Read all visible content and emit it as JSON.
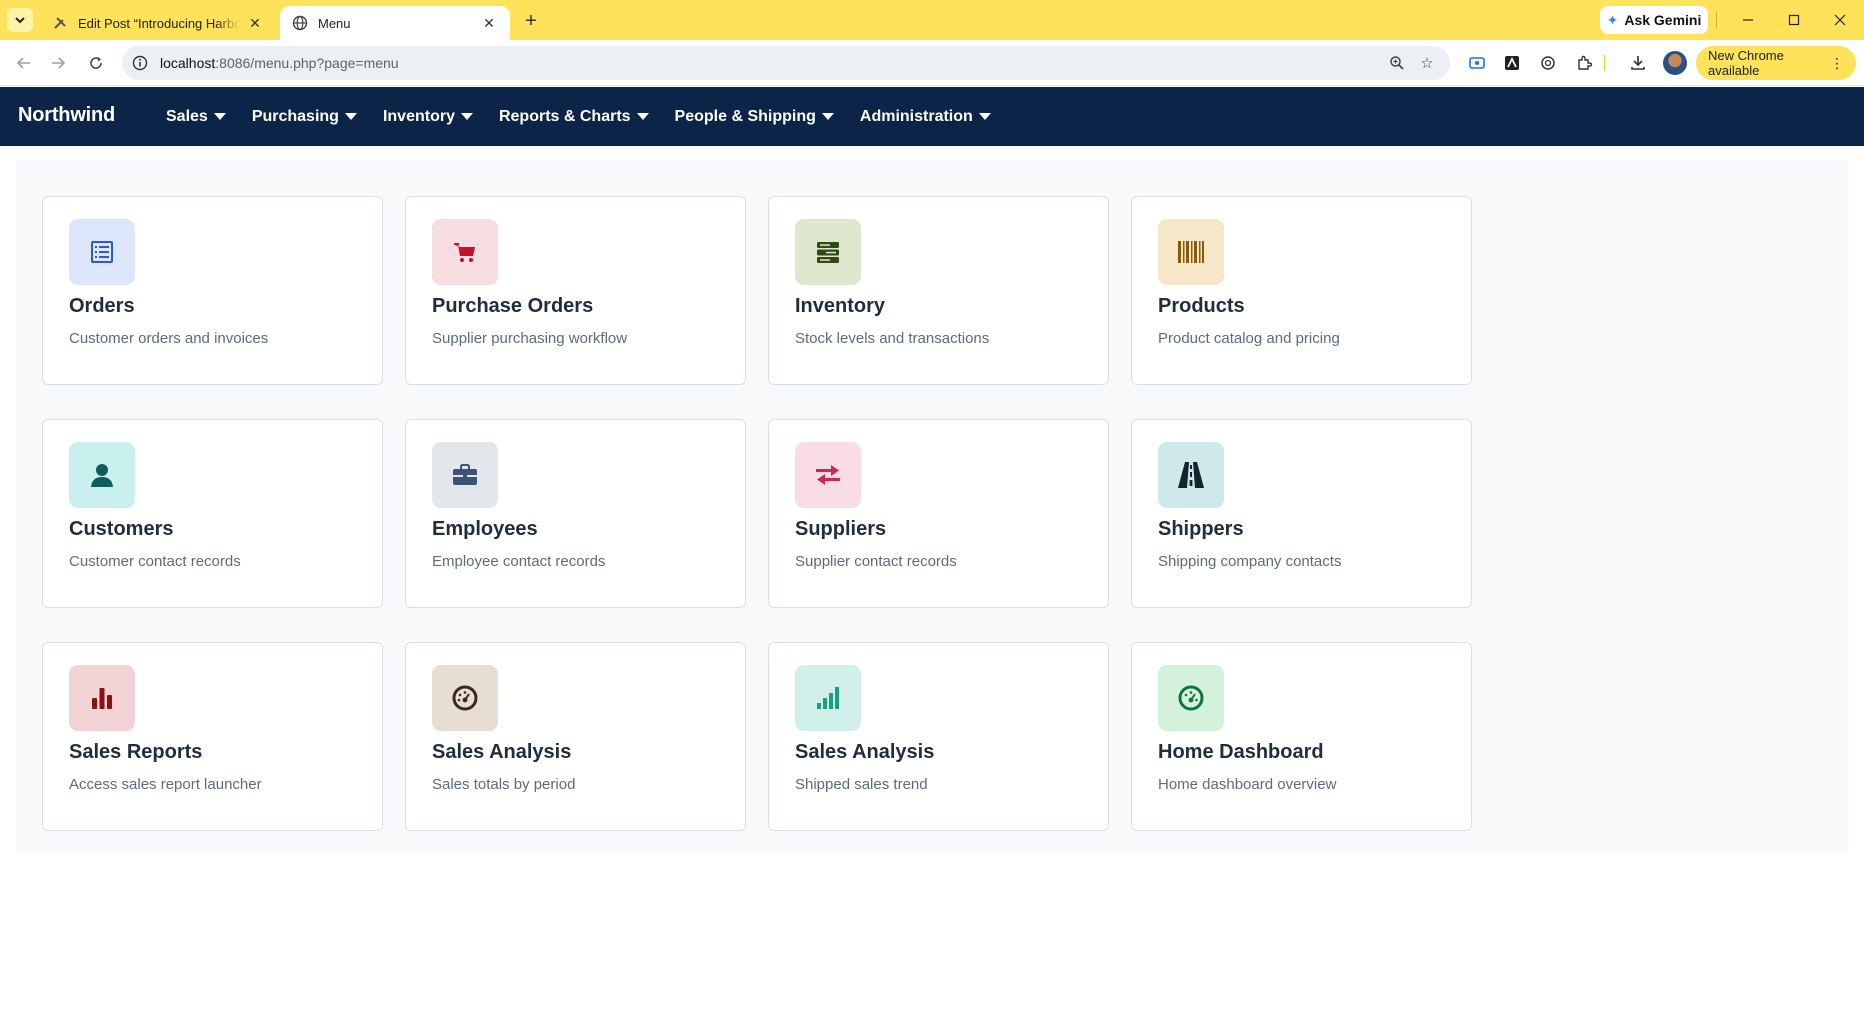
{
  "browser": {
    "tabs": [
      {
        "title": "Edit Post “Introducing Harbor: A",
        "active": false
      },
      {
        "title": "Menu",
        "active": true
      }
    ],
    "gemini_label": "Ask Gemini",
    "url_host": "localhost",
    "url_path": ":8086/menu.php?page=menu",
    "update_label": "New Chrome available"
  },
  "appnav": {
    "brand": "Northwind",
    "menus": [
      {
        "label": "Sales"
      },
      {
        "label": "Purchasing"
      },
      {
        "label": "Inventory"
      },
      {
        "label": "Reports & Charts"
      },
      {
        "label": "People & Shipping"
      },
      {
        "label": "Administration"
      }
    ]
  },
  "cards": [
    {
      "title": "Orders",
      "desc": "Customer orders and invoices",
      "icon": "list-icon",
      "tile": "#dce7fb",
      "fg": "#2a5bd7"
    },
    {
      "title": "Purchase Orders",
      "desc": "Supplier purchasing workflow",
      "icon": "cart-icon",
      "tile": "#f6dde0",
      "fg": "#c8102e"
    },
    {
      "title": "Inventory",
      "desc": "Stock levels and transactions",
      "icon": "server-icon",
      "tile": "#dfe8cf",
      "fg": "#2f4a14"
    },
    {
      "title": "Products",
      "desc": "Product catalog and pricing",
      "icon": "barcode-icon",
      "tile": "#f7e7c9",
      "fg": "#8a5a05"
    },
    {
      "title": "Customers",
      "desc": "Customer contact records",
      "icon": "user-icon",
      "tile": "#c9f0ee",
      "fg": "#0f5d5d"
    },
    {
      "title": "Employees",
      "desc": "Employee contact records",
      "icon": "briefcase-icon",
      "tile": "#e3e6eb",
      "fg": "#3b5375"
    },
    {
      "title": "Suppliers",
      "desc": "Supplier contact records",
      "icon": "exchange-icon",
      "tile": "#f8dde6",
      "fg": "#d0245a"
    },
    {
      "title": "Shippers",
      "desc": "Shipping company contacts",
      "icon": "road-icon",
      "tile": "#cfe9ea",
      "fg": "#12242e"
    },
    {
      "title": "Sales Reports",
      "desc": "Access sales report launcher",
      "icon": "bar-chart-icon",
      "tile": "#f2d3d5",
      "fg": "#8b0f14"
    },
    {
      "title": "Sales Analysis",
      "desc": "Sales totals by period",
      "icon": "gauge-icon",
      "tile": "#e8ddd2",
      "fg": "#3b2a17"
    },
    {
      "title": "Sales Analysis",
      "desc": "Shipped sales trend",
      "icon": "signal-icon",
      "tile": "#d2f0ea",
      "fg": "#1b9e86"
    },
    {
      "title": "Home Dashboard",
      "desc": "Home dashboard overview",
      "icon": "dashboard-icon",
      "tile": "#d4f1dc",
      "fg": "#13743b"
    }
  ]
}
